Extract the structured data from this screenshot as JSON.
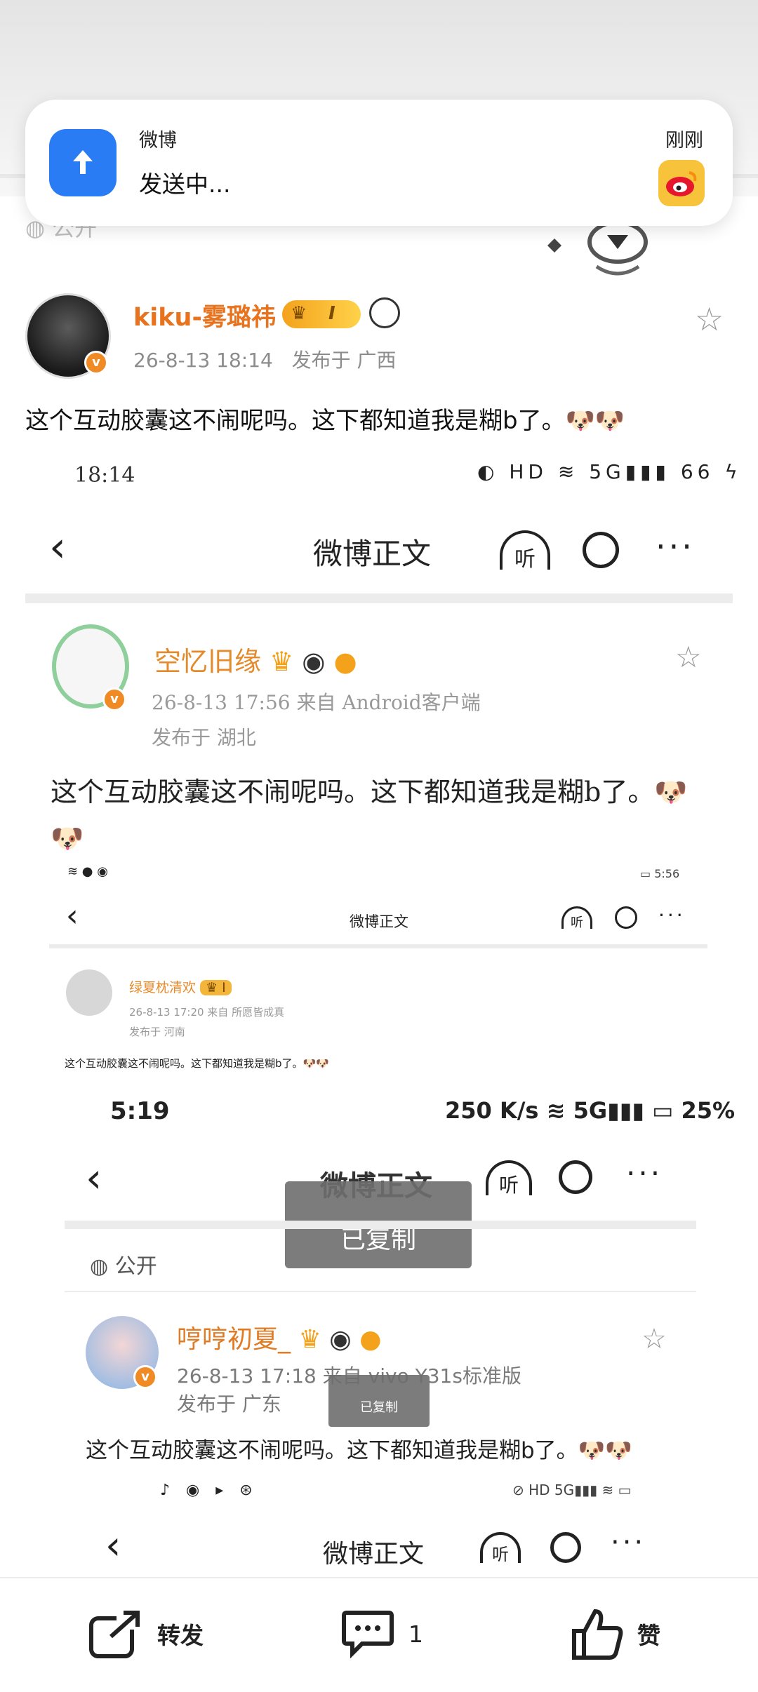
{
  "notification": {
    "app": "微博",
    "message": "发送中...",
    "time": "刚刚"
  },
  "post": {
    "ghost_public": "公开",
    "username": "kiku-雾璐祎",
    "level_badge": "I",
    "time": "26-8-13 18:14",
    "location": "发布于 广西",
    "text": "这个互动胶囊这不闹呢吗。这下都知道我是糊b了。🐶🐶"
  },
  "shot1": {
    "status_time": "18:14",
    "status_icons": "◐ HD ≋ 5G▮▮▮ 66 ϟ",
    "title": "微博正文",
    "listen": "听",
    "username": "空忆旧缘",
    "meta_line1": "26-8-13 17:56  来自 Android客户端",
    "meta_line2": "发布于 湖北",
    "text": "这个互动胶囊这不闹呢吗。这下都知道我是糊b了。🐶🐶"
  },
  "shot2": {
    "status_left": "≋ ● ◉",
    "status_right": "▭ 5:56",
    "title": "微博正文",
    "listen": "听",
    "username": "绿夏枕清欢",
    "level_badge": "I",
    "meta_line1": "26-8-13  17:20  来自  所愿皆成真",
    "meta_line2": "发布于  河南",
    "text": "这个互动胶囊这不闹呢吗。这下都知道我是糊b了。🐶🐶"
  },
  "shot3": {
    "status_time": "5:19",
    "status_right": "250 K/s ≋ 5G▮▮▮ ▭ 25%",
    "title": "微博正文",
    "listen": "听",
    "toast": "已复制",
    "public": "公开",
    "username": "哼哼初夏_",
    "meta_line1": "26-8-13 17:18  来自 vivo Y31s标准版",
    "meta_line2": "发布于 广东",
    "toast_small": "已复制",
    "text": "这个互动胶囊这不闹呢吗。这下都知道我是糊b了。🐶🐶"
  },
  "shot4": {
    "status_left": "♪ ◉ ▸ ⊛",
    "status_right": "⊘ HD 5G▮▮▮ ≋ ▭",
    "title": "微博正文",
    "listen": "听"
  },
  "actions": {
    "repost": "转发",
    "comment_count": "1",
    "like": "赞"
  },
  "colors": {
    "accent_orange": "#e8731f",
    "notif_blue": "#2a7cf5",
    "weibo_yellow": "#f7c33b"
  }
}
